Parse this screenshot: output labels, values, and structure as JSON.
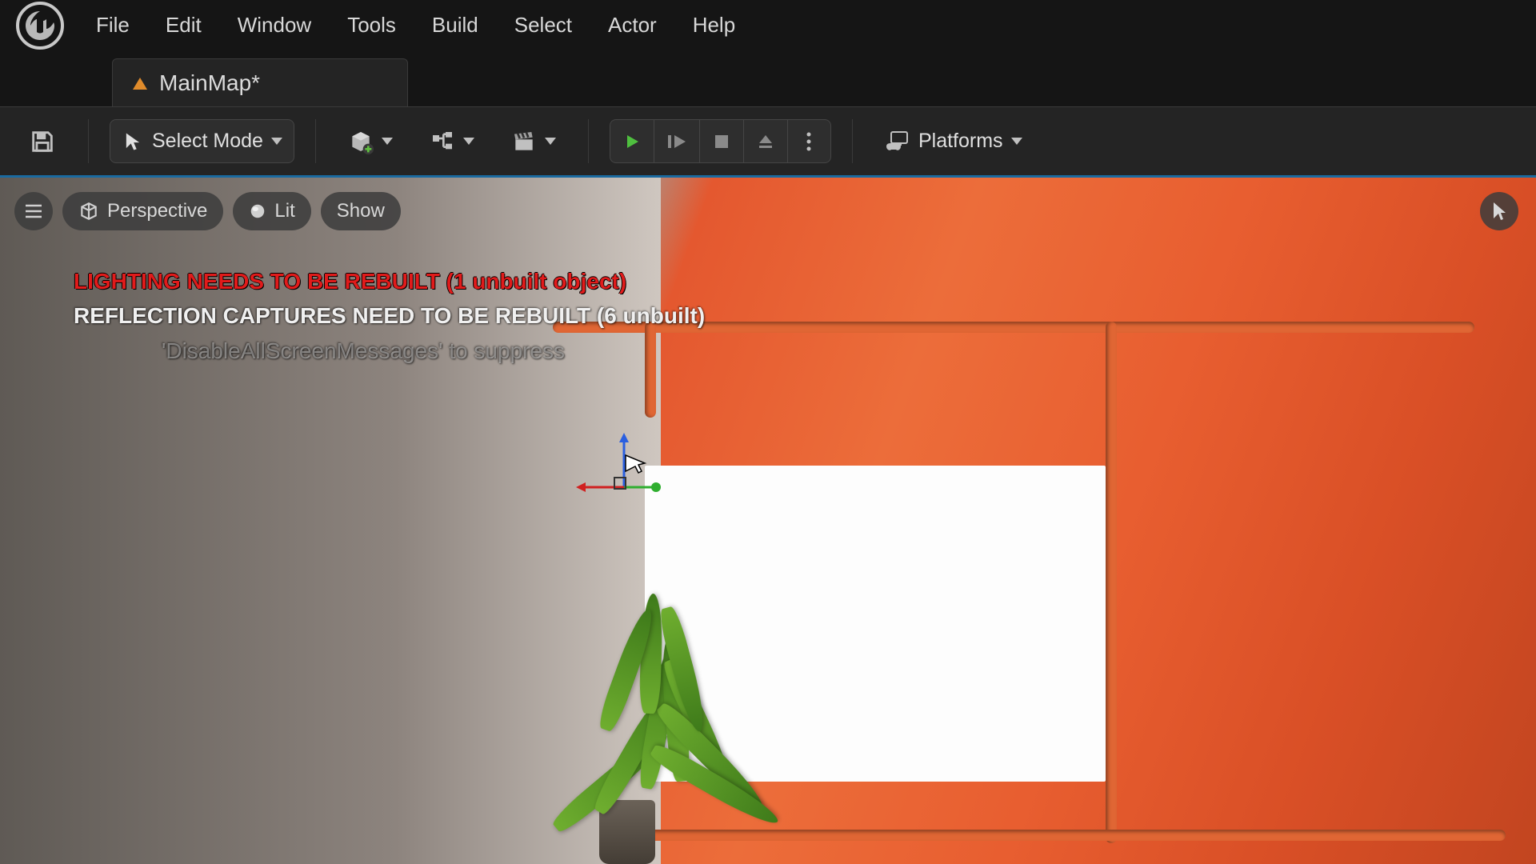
{
  "menu": {
    "items": [
      "File",
      "Edit",
      "Window",
      "Tools",
      "Build",
      "Select",
      "Actor",
      "Help"
    ]
  },
  "tab": {
    "label": "MainMap*",
    "icon": "level-icon"
  },
  "toolbar": {
    "select_mode": "Select Mode",
    "platforms": "Platforms"
  },
  "viewport": {
    "menu_btn": "≡",
    "perspective": "Perspective",
    "lit": "Lit",
    "show": "Show"
  },
  "warnings": {
    "lighting": "LIGHTING NEEDS TO BE REBUILT (1 unbuilt object)",
    "reflection": "REFLECTION CAPTURES NEED TO BE REBUILT (6 unbuilt)",
    "suppress": "'DisableAllScreenMessages' to suppress"
  }
}
